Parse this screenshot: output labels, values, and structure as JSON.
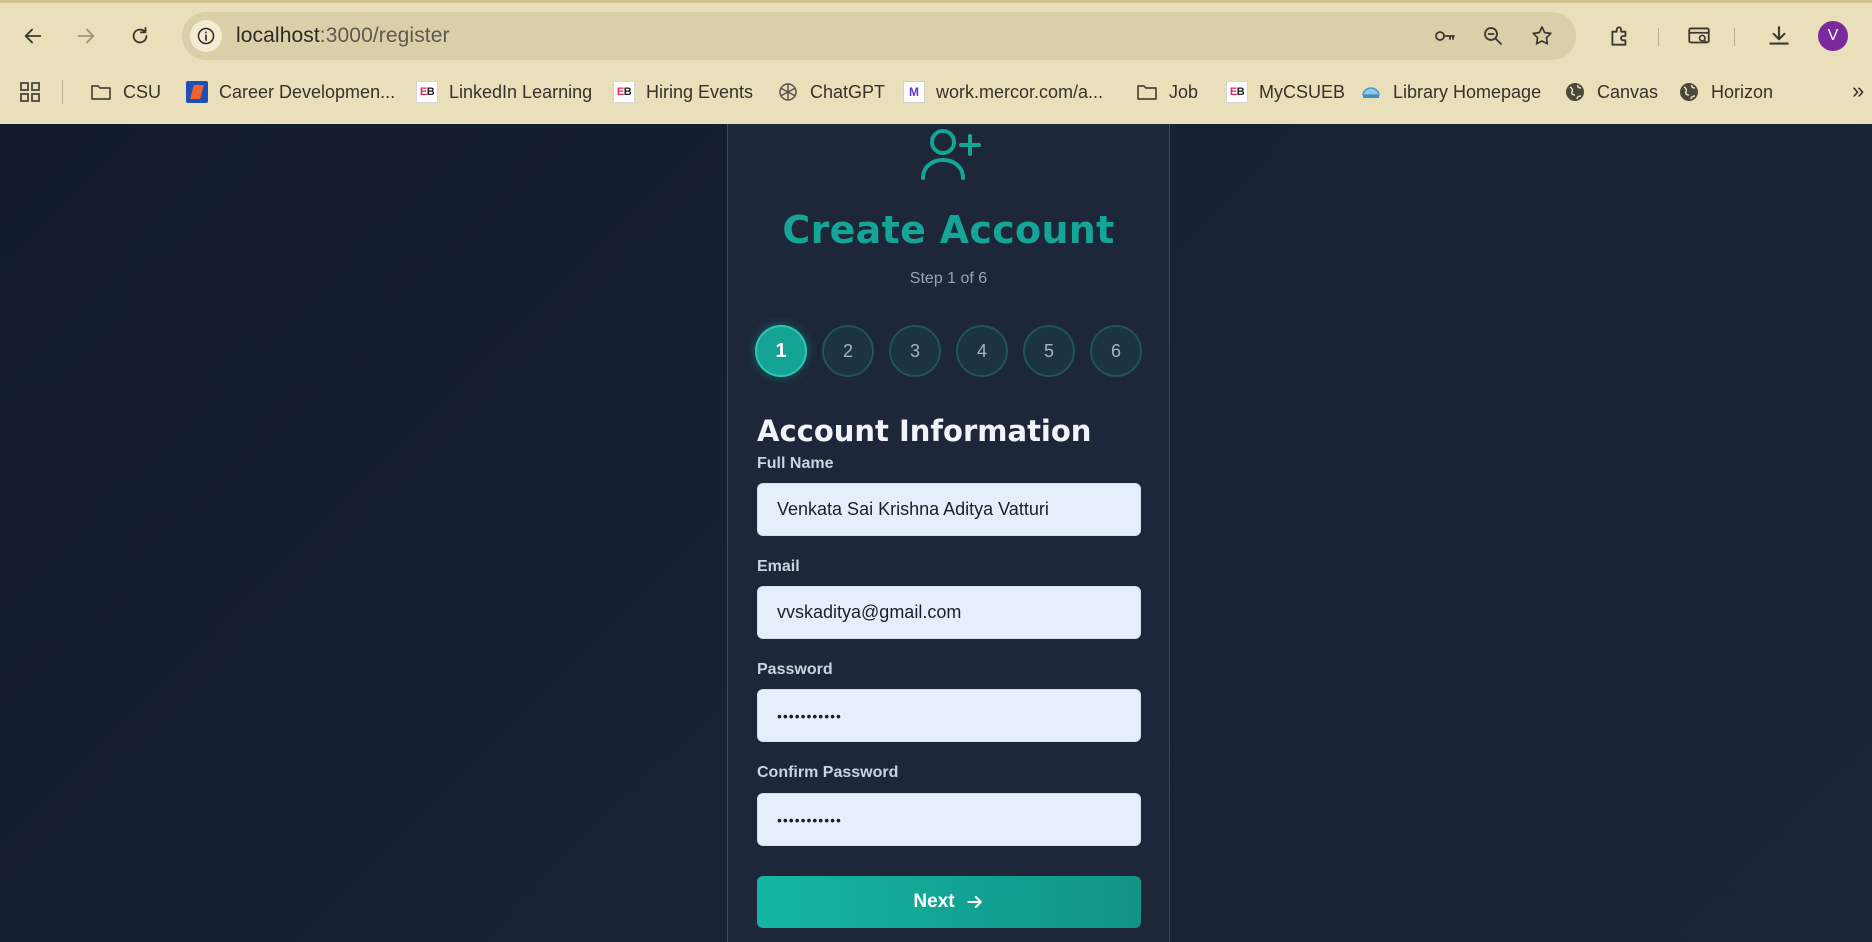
{
  "browser": {
    "url_host": "localhost",
    "url_rest": ":3000/register",
    "profile_initial": "V",
    "bookmarks": [
      {
        "label": "CSU",
        "icon": "folder-icon"
      },
      {
        "label": "Career Developmen...",
        "icon": "career-development-logo"
      },
      {
        "label": "LinkedIn Learning",
        "icon": "eb-logo"
      },
      {
        "label": "Hiring Events",
        "icon": "eb-logo"
      },
      {
        "label": "ChatGPT",
        "icon": "chatgpt-logo"
      },
      {
        "label": "work.mercor.com/a...",
        "icon": "mercor-logo"
      },
      {
        "label": "Job",
        "icon": "folder-icon"
      },
      {
        "label": "MyCSUEB",
        "icon": "eb-logo"
      },
      {
        "label": "Library Homepage",
        "icon": "library-icon"
      },
      {
        "label": "Canvas",
        "icon": "globe-icon"
      },
      {
        "label": "Horizon",
        "icon": "globe-icon"
      }
    ],
    "more_bookmarks": "»"
  },
  "form": {
    "title": "Create Account",
    "step_text": "Step 1 of 6",
    "steps": [
      "1",
      "2",
      "3",
      "4",
      "5",
      "6"
    ],
    "current_step": 1,
    "section_title": "Account Information",
    "fields": [
      {
        "label": "Full Name",
        "value": "Venkata Sai Krishna Aditya Vatturi"
      },
      {
        "label": "Email",
        "value": "vvskaditya@gmail.com"
      },
      {
        "label": "Password",
        "value": "•••••••••••"
      },
      {
        "label": "Confirm Password",
        "value": "•••••••••••"
      }
    ],
    "next_label": "Next"
  },
  "colors": {
    "accent": "#14a595",
    "chrome": "#e9dfba",
    "page_bg": "#161e2e",
    "card_bg": "#1d2739",
    "input_bg": "#e7eefb"
  }
}
